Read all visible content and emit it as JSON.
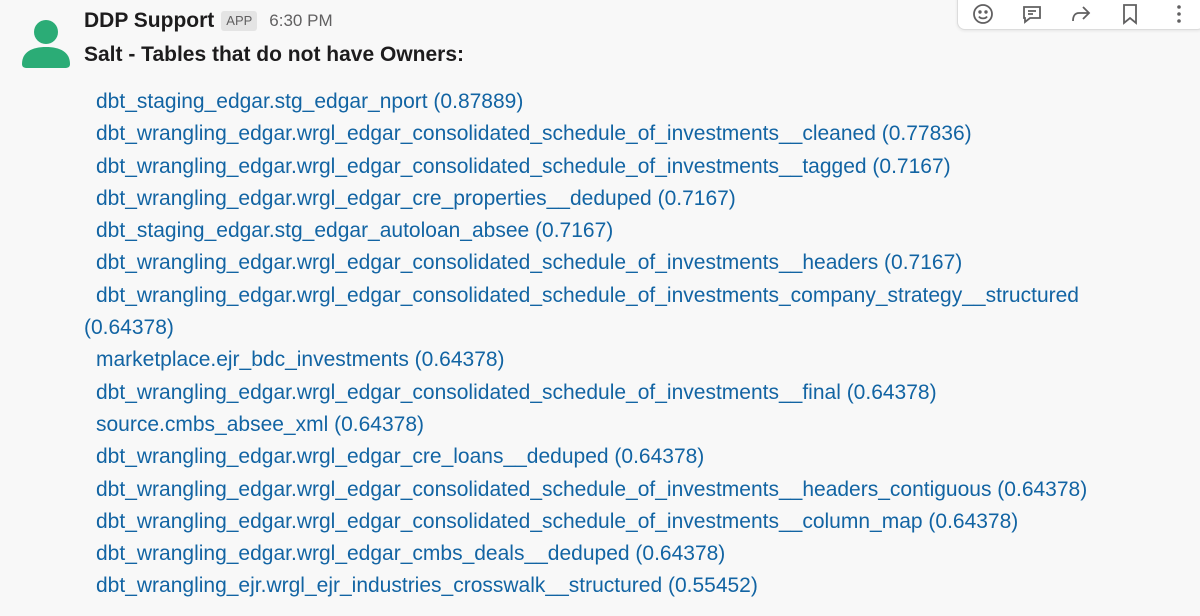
{
  "message": {
    "sender": "DDP Support",
    "badge": "APP",
    "time": "6:30 PM",
    "heading": "Salt - Tables that do not have Owners:"
  },
  "toolbar": {
    "icons": [
      "emoji-reaction-icon",
      "reply-in-thread-icon",
      "share-icon",
      "bookmark-icon",
      "more-actions-icon"
    ]
  },
  "items": [
    "dbt_staging_edgar.stg_edgar_nport (0.87889)",
    "dbt_wrangling_edgar.wrgl_edgar_consolidated_schedule_of_investments__cleaned (0.77836)",
    "dbt_wrangling_edgar.wrgl_edgar_consolidated_schedule_of_investments__tagged (0.7167)",
    "dbt_wrangling_edgar.wrgl_edgar_cre_properties__deduped (0.7167)",
    "dbt_staging_edgar.stg_edgar_autoloan_absee (0.7167)",
    "dbt_wrangling_edgar.wrgl_edgar_consolidated_schedule_of_investments__headers (0.7167)",
    "dbt_wrangling_edgar.wrgl_edgar_consolidated_schedule_of_investments_company_strategy__structured (0.64378)",
    "marketplace.ejr_bdc_investments (0.64378)",
    "dbt_wrangling_edgar.wrgl_edgar_consolidated_schedule_of_investments__final (0.64378)",
    "source.cmbs_absee_xml (0.64378)",
    "dbt_wrangling_edgar.wrgl_edgar_cre_loans__deduped (0.64378)",
    "dbt_wrangling_edgar.wrgl_edgar_consolidated_schedule_of_investments__headers_contiguous (0.64378)",
    "dbt_wrangling_edgar.wrgl_edgar_consolidated_schedule_of_investments__column_map (0.64378)",
    "dbt_wrangling_edgar.wrgl_edgar_cmbs_deals__deduped (0.64378)",
    "dbt_wrangling_ejr.wrgl_ejr_industries_crosswalk__structured (0.55452)"
  ],
  "colors": {
    "link": "#1264a3",
    "avatar": "#2bac76",
    "text": "#1d1c1d",
    "muted": "#616061"
  }
}
